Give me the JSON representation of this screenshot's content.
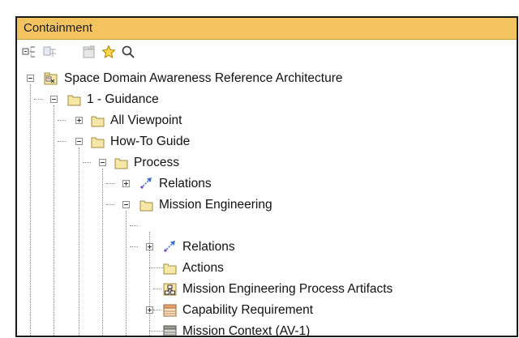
{
  "panel": {
    "title": "Containment"
  },
  "toolbar": {
    "buttons": [
      {
        "icon": "collapse-all-icon"
      },
      {
        "icon": "expand-all-icon"
      },
      {
        "icon": "package-icon"
      },
      {
        "icon": "favorites-star-icon"
      },
      {
        "icon": "search-icon"
      }
    ]
  },
  "tree": {
    "nodes": [
      {
        "label": "Space Domain Awareness Reference Architecture",
        "icon": "model-icon",
        "expander": "minus"
      },
      {
        "label": "1 - Guidance",
        "icon": "folder-icon",
        "expander": "minus"
      },
      {
        "label": "All Viewpoint",
        "icon": "folder-icon",
        "expander": "plus"
      },
      {
        "label": "How-To Guide",
        "icon": "folder-icon",
        "expander": "minus"
      },
      {
        "label": "Process",
        "icon": "folder-icon",
        "expander": "minus"
      },
      {
        "label": "Relations",
        "icon": "relation-icon",
        "expander": "plus"
      },
      {
        "label": "Mission Engineering",
        "icon": "folder-icon",
        "expander": "minus"
      },
      {
        "label": "Relations",
        "icon": "relation-icon",
        "expander": "plus"
      },
      {
        "label": "Actions",
        "icon": "folder-icon",
        "expander": "none"
      },
      {
        "label": "Mission Engineering Process Artifacts",
        "icon": "diagram-icon",
        "expander": "none"
      },
      {
        "label": "Capability Requirement",
        "icon": "table-icon",
        "expander": "plus"
      },
      {
        "label": "Mission Context (AV-1)",
        "icon": "table-gray-icon",
        "expander": "none"
      }
    ]
  },
  "colors": {
    "title_bar": "#f2c35e",
    "folder": "#f6e7a6",
    "relation": "#3a6fd1"
  }
}
